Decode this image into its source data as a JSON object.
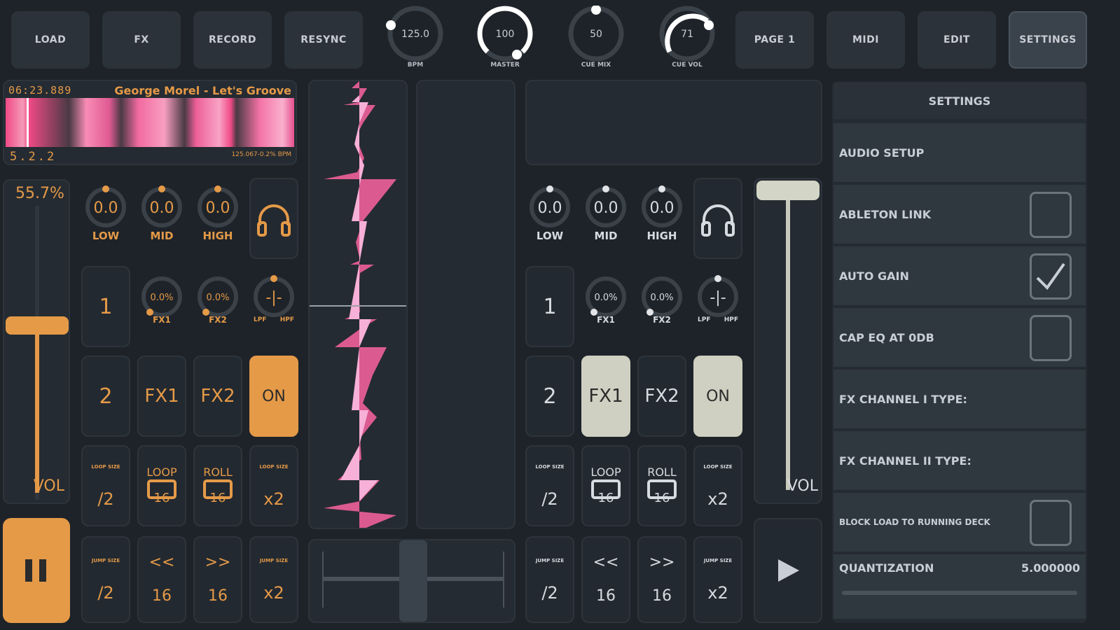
{
  "top": {
    "load": "LOAD",
    "fx": "FX",
    "record": "RECORD",
    "resync": "RESYNC",
    "page": "PAGE 1",
    "midi": "MIDI",
    "edit": "EDIT",
    "settings": "SETTINGS",
    "knobs": [
      {
        "value": "125.0",
        "label": "BPM"
      },
      {
        "value": "100",
        "label": "MASTER"
      },
      {
        "value": "50",
        "label": "CUE MIX"
      },
      {
        "value": "71",
        "label": "CUE VOL"
      }
    ]
  },
  "deckA": {
    "time": "06:23.889",
    "title": "George Morel - Let's Groove",
    "beat": "5.2.2",
    "bpm_info": "125.067-0.2% BPM",
    "pitch": "55.7%",
    "vol_label": "VOL",
    "eq": [
      {
        "value": "0.0",
        "label": "LOW"
      },
      {
        "value": "0.0",
        "label": "MID"
      },
      {
        "value": "0.0",
        "label": "HIGH"
      }
    ],
    "fx_knobs": [
      {
        "value": "0.0%",
        "label": "FX1"
      },
      {
        "value": "0.0%",
        "label": "FX2"
      }
    ],
    "filter_labels": [
      "LPF",
      "HPF"
    ],
    "pad1": "1",
    "pad2": "2",
    "fx1": "FX1",
    "fx2": "FX2",
    "on": "ON",
    "loop_size": "LOOP SIZE",
    "jump_size": "JUMP SIZE",
    "div2": "/2",
    "mul2": "x2",
    "loop": "LOOP",
    "roll": "ROLL",
    "sixteen": "16",
    "back": "<<",
    "fwd": ">>"
  },
  "deckB": {
    "vol_label": "VOL",
    "eq": [
      {
        "value": "0.0",
        "label": "LOW"
      },
      {
        "value": "0.0",
        "label": "MID"
      },
      {
        "value": "0.0",
        "label": "HIGH"
      }
    ],
    "fx_knobs": [
      {
        "value": "0.0%",
        "label": "FX1"
      },
      {
        "value": "0.0%",
        "label": "FX2"
      }
    ],
    "filter_labels": [
      "LPF",
      "HPF"
    ],
    "pad1": "1",
    "pad2": "2",
    "fx1": "FX1",
    "fx2": "FX2",
    "on": "ON",
    "loop_size": "LOOP SIZE",
    "jump_size": "JUMP SIZE",
    "div2": "/2",
    "mul2": "x2",
    "loop": "LOOP",
    "roll": "ROLL",
    "sixteen": "16",
    "back": "<<",
    "fwd": ">>"
  },
  "settings": {
    "title": "SETTINGS",
    "audio_setup": "AUDIO SETUP",
    "ableton_link": "ABLETON LINK",
    "auto_gain": "AUTO GAIN",
    "cap_eq": "CAP EQ AT 0DB",
    "fx_ch1": "FX CHANNEL I TYPE:",
    "fx_ch2": "FX CHANNEL II TYPE:",
    "block_load": "BLOCK LOAD TO RUNNING DECK",
    "quantization": "QUANTIZATION",
    "quantization_value": "5.000000",
    "ableton_link_checked": false,
    "auto_gain_checked": true,
    "cap_eq_checked": false,
    "block_load_checked": false
  },
  "colors": {
    "orange": "#e59a48",
    "waveform": "#f0609a",
    "panel": "#252b32"
  }
}
